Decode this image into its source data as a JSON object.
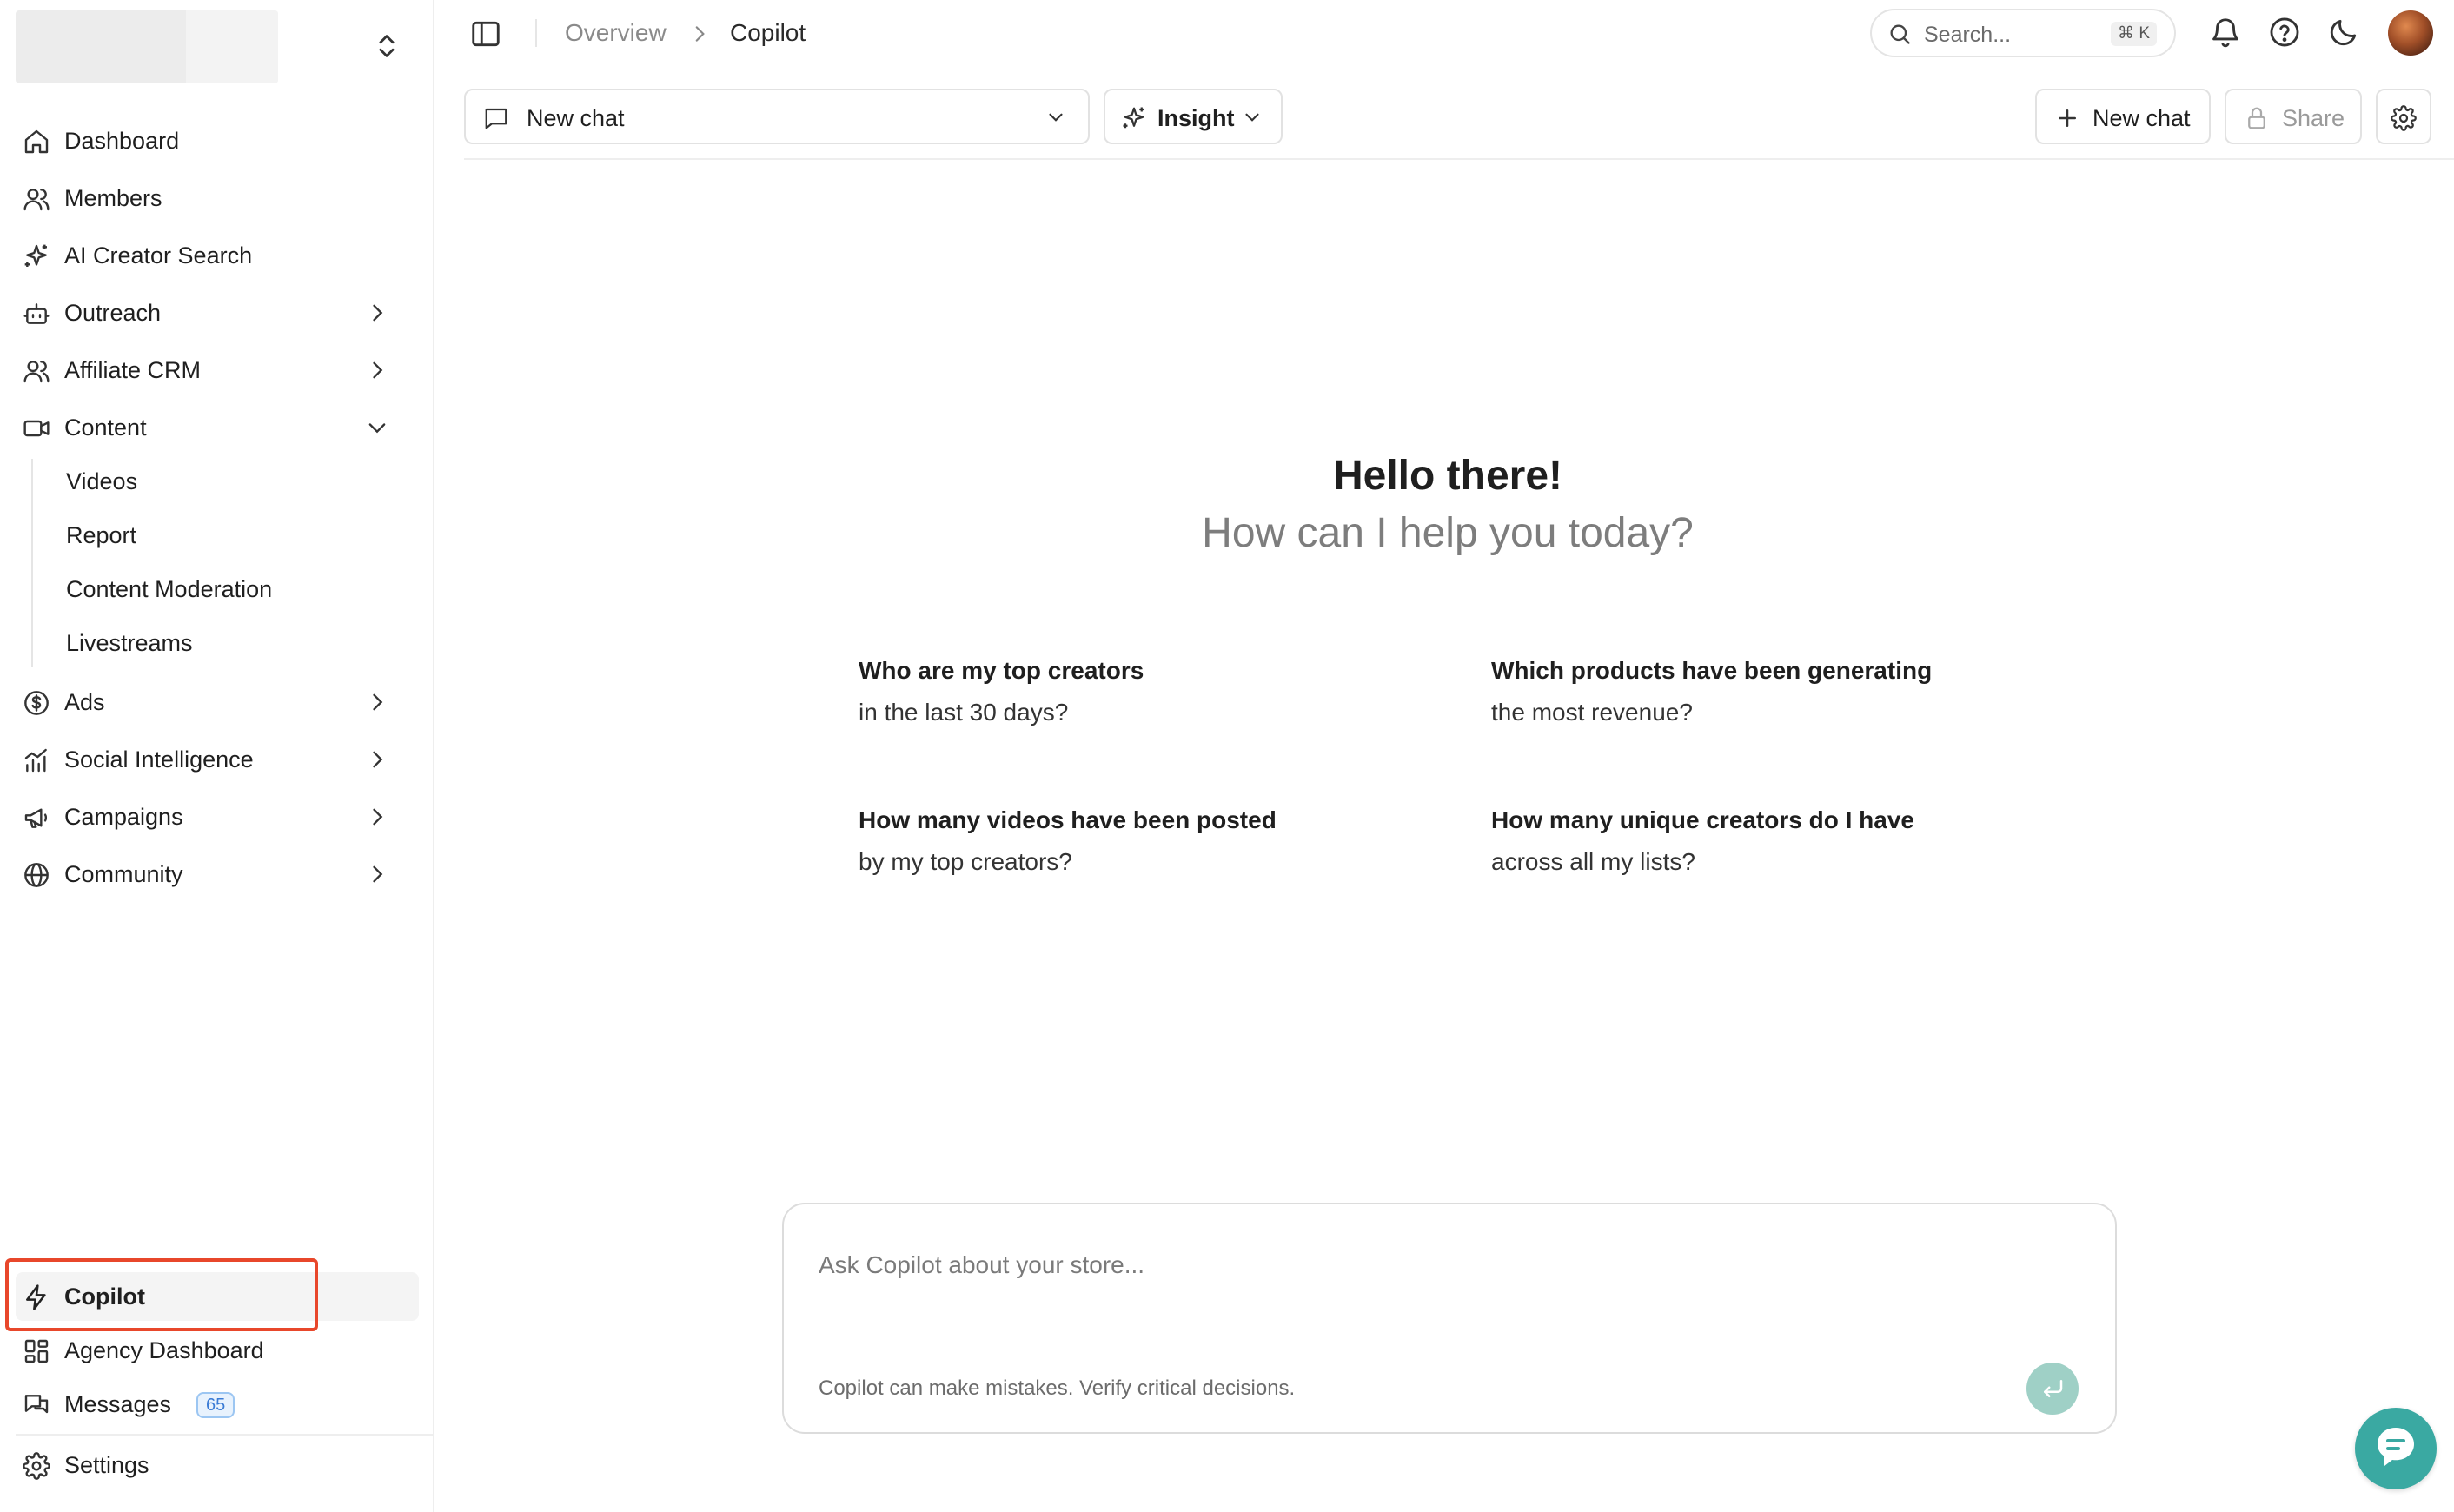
{
  "sidebar": {
    "items": [
      {
        "label": "Dashboard",
        "icon": "home-icon"
      },
      {
        "label": "Members",
        "icon": "users-icon"
      },
      {
        "label": "AI Creator Search",
        "icon": "sparkles-icon"
      },
      {
        "label": "Outreach",
        "icon": "bot-icon"
      },
      {
        "label": "Affiliate CRM",
        "icon": "users-icon"
      },
      {
        "label": "Content",
        "icon": "video-icon"
      },
      {
        "label": "Ads",
        "icon": "dollar-circle-icon"
      },
      {
        "label": "Social Intelligence",
        "icon": "chart-bar-icon"
      },
      {
        "label": "Campaigns",
        "icon": "megaphone-icon"
      },
      {
        "label": "Community",
        "icon": "globe-icon"
      }
    ],
    "content_subitems": [
      "Videos",
      "Report",
      "Content Moderation",
      "Livestreams"
    ],
    "bottom_items": [
      {
        "label": "Copilot",
        "icon": "lightning-icon"
      },
      {
        "label": "Agency Dashboard",
        "icon": "layout-grid-icon"
      },
      {
        "label": "Messages",
        "icon": "messages-icon",
        "badge": "65"
      },
      {
        "label": "Settings",
        "icon": "gear-icon"
      }
    ]
  },
  "header": {
    "breadcrumb": {
      "parent": "Overview",
      "current": "Copilot"
    },
    "search": {
      "placeholder": "Search...",
      "shortcut": "⌘ K"
    }
  },
  "toolbar": {
    "chat_select_label": "New chat",
    "mode_label": "Insight",
    "new_chat_label": "New chat",
    "share_label": "Share"
  },
  "welcome": {
    "title": "Hello there!",
    "subtitle": "How can I help you today?",
    "suggestions": [
      {
        "line1": "Who are my top creators",
        "line2": "in the last 30 days?"
      },
      {
        "line1": "Which products have been generating",
        "line2": "the most revenue?"
      },
      {
        "line1": "How many videos have been posted",
        "line2": "by my top creators?"
      },
      {
        "line1": "How many unique creators do I have",
        "line2": "across all my lists?"
      }
    ]
  },
  "composer": {
    "placeholder": "Ask Copilot about your store...",
    "disclaimer": "Copilot can make mistakes. Verify critical decisions."
  },
  "colors": {
    "highlight": "#e8472b",
    "send_button": "#9fd0c6",
    "chat_fab": "#3aa9a2",
    "badge": "#3a7bd5"
  }
}
